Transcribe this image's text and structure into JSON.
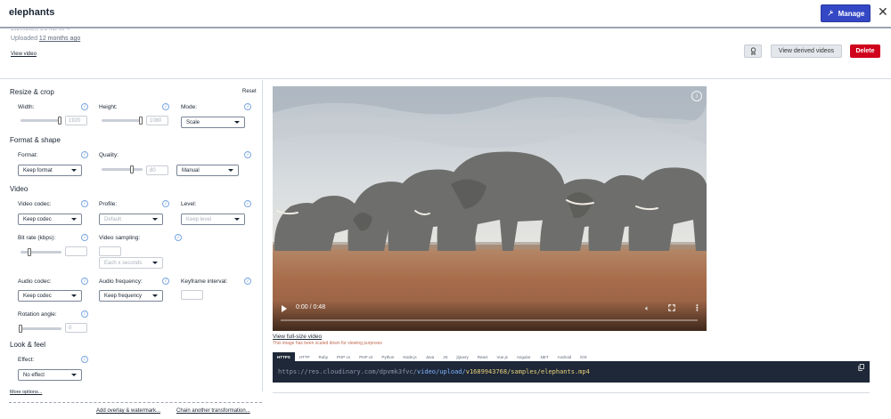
{
  "header": {
    "title": "elephants",
    "manage_label": "Manage"
  },
  "info": {
    "meta_line": "1920x1080, 5.5 MB MP4",
    "uploaded_prefix": "Uploaded",
    "uploaded_rel": "12 months ago",
    "view_video": "View video",
    "derived_label": "View derived videos",
    "delete_label": "Delete"
  },
  "resize": {
    "section": "Resize & crop",
    "reset": "Reset",
    "width_label": "Width:",
    "width_value": "1920",
    "width_fill": 0.98,
    "height_label": "Height:",
    "height_value": "1080",
    "height_fill": 0.98,
    "mode_label": "Mode:",
    "mode_value": "Scale"
  },
  "format": {
    "section": "Format & shape",
    "format_label": "Format:",
    "format_value": "Keep format",
    "quality_label": "Quality:",
    "quality_value": "80",
    "quality_fill": 0.8,
    "quality_mode": "Manual"
  },
  "video": {
    "section": "Video",
    "codec_label": "Video codec:",
    "codec_value": "Keep codec",
    "profile_label": "Profile:",
    "profile_value": "Default",
    "level_label": "Level:",
    "level_value": "Keep level",
    "bitrate_label": "Bit rate (kbps):",
    "bitrate_fill": 0.2,
    "sampling_label": "Video sampling:",
    "sampling_value": "Each x seconds",
    "audio_codec_label": "Audio codec:",
    "audio_codec_value": "Keep codec",
    "audio_freq_label": "Audio frequency:",
    "audio_freq_value": "Keep frequency",
    "keyframe_label": "Keyframe interval:",
    "rotation_label": "Rotation angle:",
    "rotation_value": "0"
  },
  "look": {
    "section": "Look & feel",
    "effect_label": "Effect:",
    "effect_value": "No effect",
    "more_options": "More options..."
  },
  "bottom_links": {
    "overlay": "Add overlay & watermark...",
    "chain": "Chain another transformation..."
  },
  "player": {
    "time": "0:00 / 0:48",
    "progress": 0.0
  },
  "preview": {
    "full_size": "View full-size video",
    "scaled_note": "This image has been scaled down for viewing purposes"
  },
  "code": {
    "tabs": [
      "HTTPS",
      "HTTP",
      "Ruby",
      "PHP v1",
      "PHP v2",
      "Python",
      "Node.js",
      "Java",
      "JS",
      "jQuery",
      "React",
      "Vue.js",
      "Angular",
      ".NET",
      "Android",
      "iOS"
    ],
    "active_tab": "HTTPS",
    "url_base": "https://res.cloudinary.com/dpvmk3fvc/",
    "url_path": "video/upload/",
    "url_rest": "v1689943768/samples/elephants.mp4"
  },
  "colors": {
    "accent": "#3448c5",
    "danger": "#d0021b",
    "code_bg": "#1e2838"
  }
}
